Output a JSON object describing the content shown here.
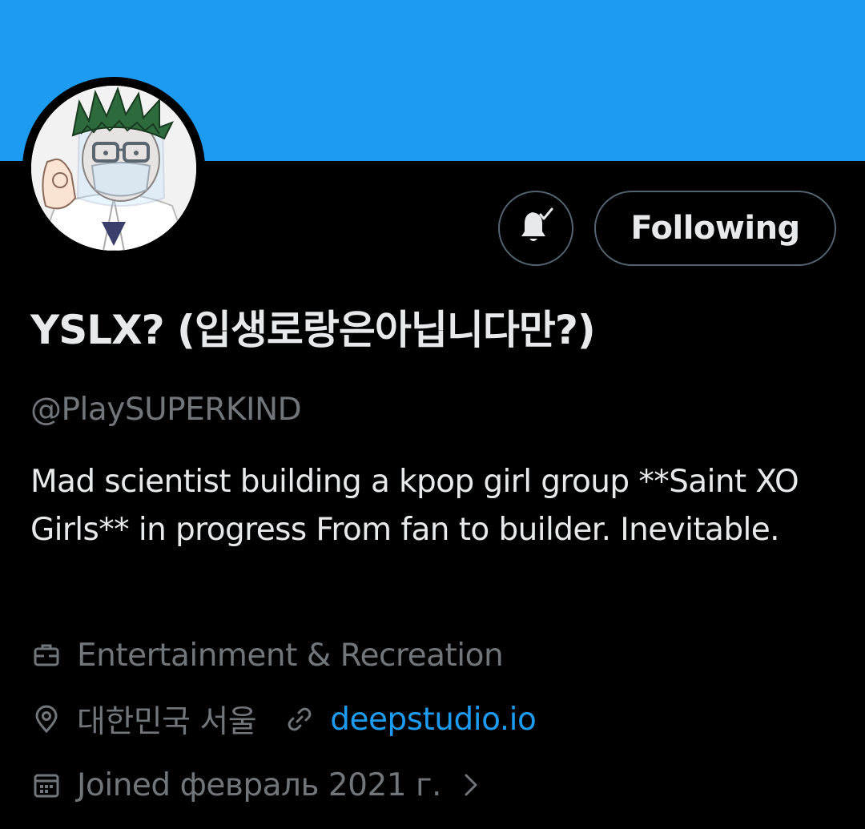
{
  "profile": {
    "display_name": "YSLX? (입생로랑은아닙니다만?)",
    "handle": "@PlaySUPERKIND",
    "bio": "Mad scientist building a kpop girl group **Saint XO Girls** in progress From fan to builder. Inevitable.",
    "category": "Entertainment & Recreation",
    "location": "대한민국 서울",
    "website": "deepstudio.io",
    "joined": "Joined февраль 2021 г."
  },
  "actions": {
    "following_label": "Following",
    "notification_icon": "bell-check-icon"
  },
  "colors": {
    "banner": "#1d9bf0",
    "background": "#000000",
    "primary_text": "#e7e9ea",
    "secondary_text": "#71767b",
    "link": "#1d9bf0",
    "button_border": "#536471"
  },
  "icons": {
    "category": "briefcase-icon",
    "location": "map-pin-icon",
    "website": "link-icon",
    "joined": "calendar-icon",
    "expand": "chevron-right-icon"
  }
}
